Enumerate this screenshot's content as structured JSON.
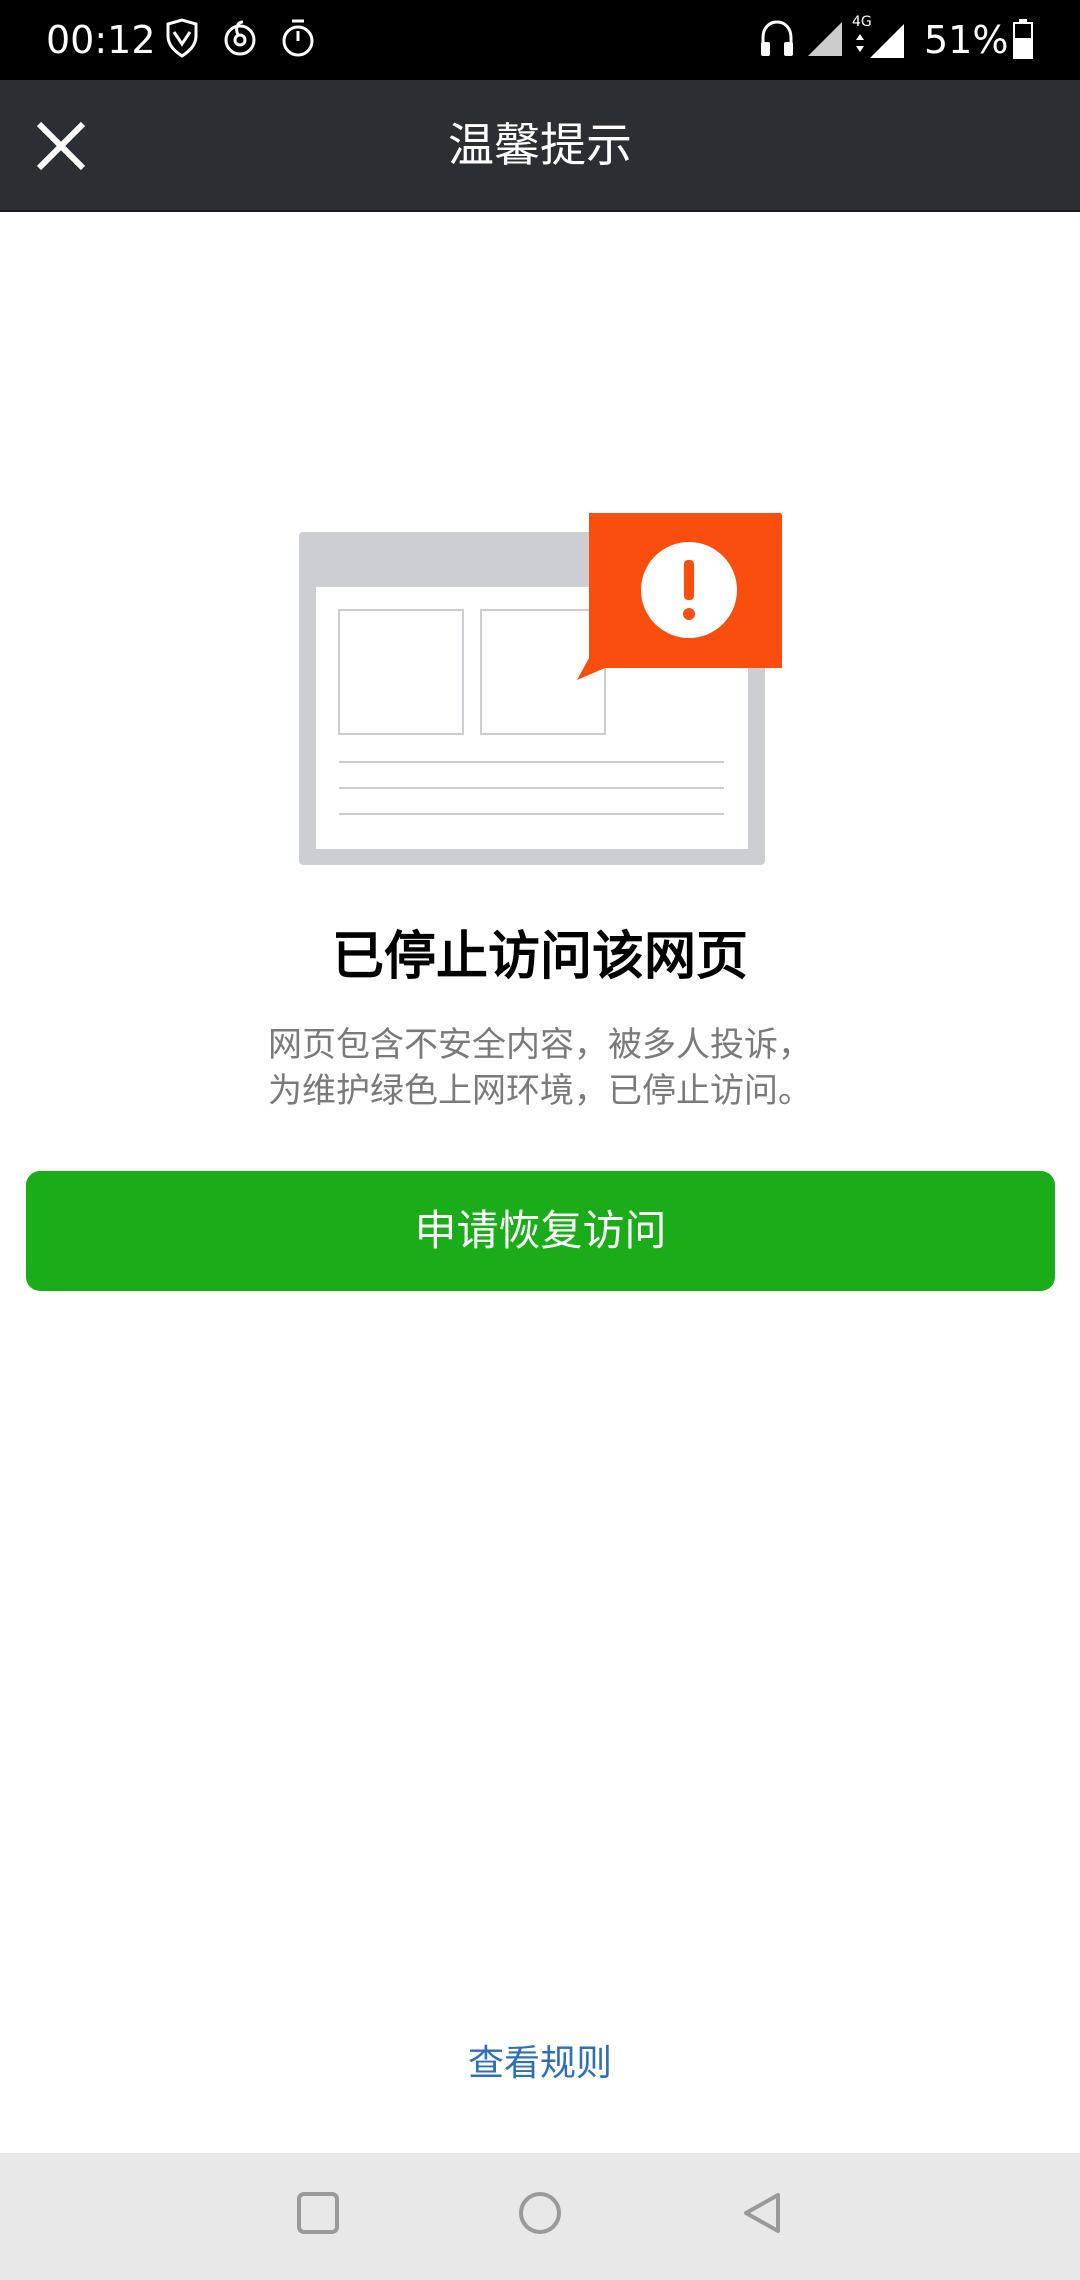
{
  "status_bar": {
    "time": "00:12",
    "battery": "51%",
    "network": "4G",
    "left_icons": [
      "shield-icon",
      "netease-music-icon",
      "timer-icon"
    ],
    "right_icons": [
      "headphone-icon",
      "signal-icon",
      "signal-4g-icon",
      "battery-icon"
    ]
  },
  "header": {
    "title": "温馨提示",
    "close_icon": "close-icon"
  },
  "main": {
    "illustration_icon": "blocked-webpage-warning-icon",
    "headline": "已停止访问该网页",
    "description_line1": "网页包含不安全内容，被多人投诉，",
    "description_line2": "为维护绿色上网环境，已停止访问。",
    "appeal_button": "申请恢复访问",
    "rules_link": "查看规则"
  },
  "system_nav": {
    "icons": [
      "recent-apps-icon",
      "home-icon",
      "back-icon"
    ]
  },
  "colors": {
    "button_green": "#1aad19",
    "warning_red": "#fa4e0f",
    "link_blue": "#2f6fb3",
    "header_bg": "#2b2e33"
  }
}
